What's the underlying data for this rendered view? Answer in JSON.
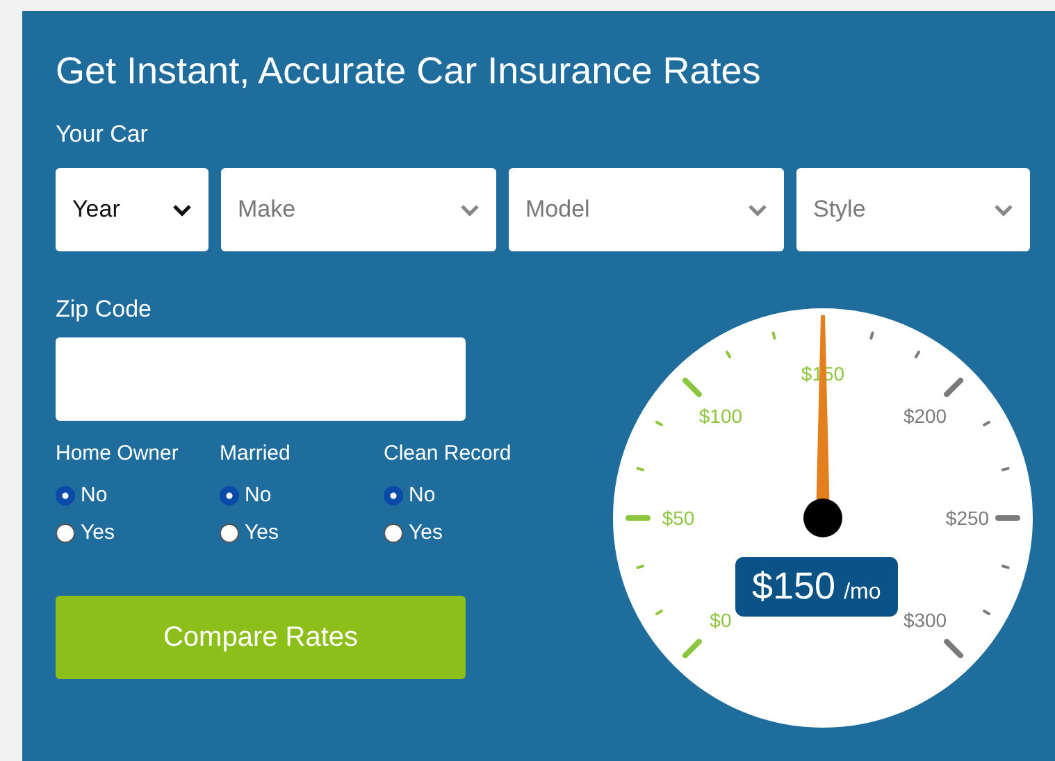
{
  "title": "Get Instant, Accurate Car Insurance Rates",
  "car_label": "Your Car",
  "selects": [
    {
      "value": "Year"
    },
    {
      "placeholder": "Make"
    },
    {
      "placeholder": "Model"
    },
    {
      "placeholder": "Style"
    }
  ],
  "zip": {
    "label": "Zip Code"
  },
  "radio_groups": [
    {
      "label": "Home Owner",
      "options": [
        {
          "label": "No",
          "selected": true
        },
        {
          "label": "Yes",
          "selected": false
        }
      ]
    },
    {
      "label": "Married",
      "options": [
        {
          "label": "No",
          "selected": true
        },
        {
          "label": "Yes",
          "selected": false
        }
      ]
    },
    {
      "label": "Clean Record",
      "options": [
        {
          "label": "No",
          "selected": true
        },
        {
          "label": "Yes",
          "selected": false
        }
      ]
    }
  ],
  "button": "Compare Rates",
  "gauge": {
    "labels": [
      {
        "text": "$0",
        "reached": true
      },
      {
        "text": "$50",
        "reached": true
      },
      {
        "text": "$100",
        "reached": true
      },
      {
        "text": "$150",
        "reached": true
      },
      {
        "text": "$200",
        "reached": false
      },
      {
        "text": "$250",
        "reached": false
      },
      {
        "text": "$300",
        "reached": false
      }
    ],
    "readout": "$150",
    "unit": "/mo"
  }
}
